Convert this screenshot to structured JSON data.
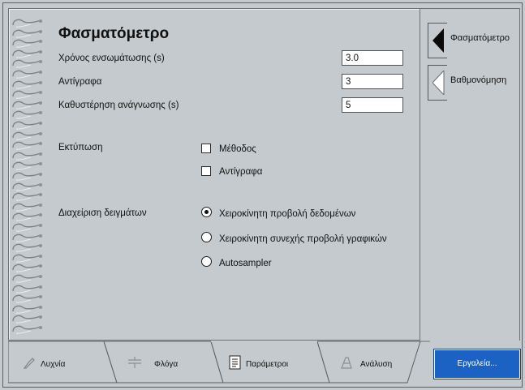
{
  "panel": {
    "title": "Φασματόμετρο",
    "fields": [
      {
        "label": "Χρόνος ενσωμάτωσης (s)",
        "value": "3.0"
      },
      {
        "label": "Αντίγραφα",
        "value": "3"
      },
      {
        "label": "Καθυστέρηση ανάγνωσης (s)",
        "value": "5"
      }
    ],
    "print_label": "Εκτύπωση",
    "print_options": [
      {
        "label": "Μέθοδος",
        "checked": false
      },
      {
        "label": "Αντίγραφα",
        "checked": false
      }
    ],
    "sample_label": "Διαχείριση δειγμάτων",
    "sample_options": [
      {
        "label": "Χειροκίνητη προβολή δεδομένων",
        "selected": true
      },
      {
        "label": "Χειροκίνητη συνεχής προβολή γραφικών",
        "selected": false
      },
      {
        "label": "Autosampler",
        "selected": false
      }
    ]
  },
  "side_nav": [
    {
      "label": "Φασματόμετρο",
      "active": true
    },
    {
      "label": "Βαθμονόμηση",
      "active": false
    }
  ],
  "tabs": [
    {
      "label": "Λυχνία",
      "icon": "lamp-icon"
    },
    {
      "label": "Φλόγα",
      "icon": "flame-icon"
    },
    {
      "label": "Παράμετροι",
      "icon": "parameters-icon",
      "active": true
    },
    {
      "label": "Ανάλυση",
      "icon": "analysis-icon"
    }
  ],
  "tools_button": "Εργαλεία...",
  "colors": {
    "background": "#c4cacd",
    "accent": "#1c62c4"
  }
}
